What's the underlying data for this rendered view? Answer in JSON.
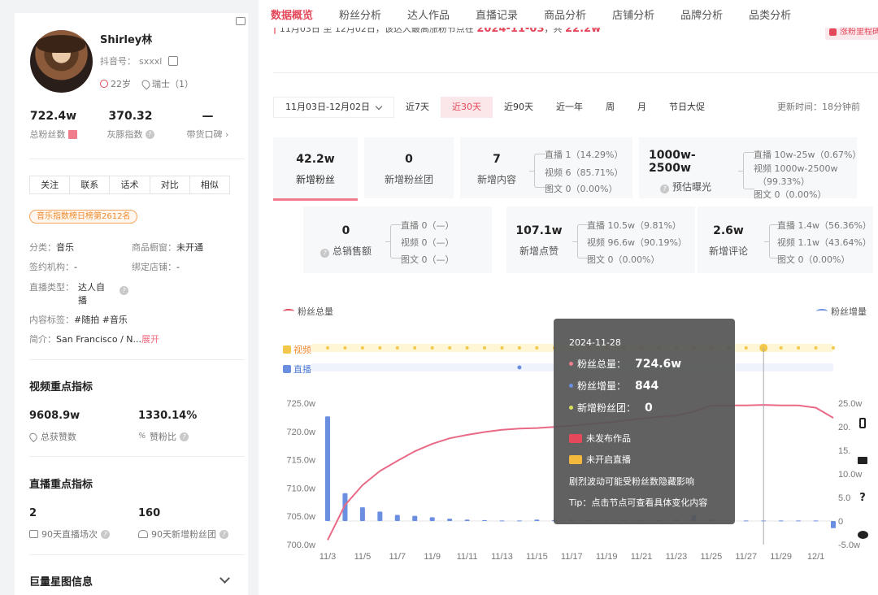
{
  "profile": {
    "name": "Shirley林",
    "douyin_label": "抖音号：",
    "douyin_id": "sxxxl",
    "age": "22岁",
    "location": "瑞士（1）",
    "stats": [
      {
        "value": "722.4w",
        "label": "总粉丝数"
      },
      {
        "value": "370.32",
        "label": "灰豚指数"
      },
      {
        "value": "—",
        "label": "带货口碑 ›"
      }
    ],
    "buttons": [
      "关注",
      "联系",
      "话术",
      "对比",
      "相似"
    ],
    "rank_badge": "音乐指数榜日榜第2612名",
    "info": {
      "category_label": "分类：",
      "category": "音乐",
      "window_label": "商品橱窗：",
      "window": "未开通",
      "agency_label": "签约机构：",
      "agency": "-",
      "shop_label": "绑定店铺：",
      "shop": "-",
      "live_type_label": "直播类型：",
      "live_type_1": "达人自",
      "live_type_2": "播",
      "tags_label": "内容标签：",
      "tags": "#随拍 #音乐",
      "bio_label": "简介：",
      "bio": "San Francisco / N...",
      "expand": "展开"
    },
    "video_section": {
      "title": "视频重点指标",
      "likes_value": "9608.9w",
      "likes_label": "总获赞数",
      "ratio_value": "1330.14%",
      "ratio_label": "赞粉比"
    },
    "live_section": {
      "title": "直播重点指标",
      "sessions_value": "2",
      "sessions_label": "90天直播场次",
      "fangroup_value": "160",
      "fangroup_label": "90天新增粉丝团"
    },
    "star_section": {
      "title": "巨量星图信息"
    }
  },
  "tabs": [
    "数据概览",
    "粉丝分析",
    "达人作品",
    "直播记录",
    "商品分析",
    "店铺分析",
    "品牌分析",
    "品类分析"
  ],
  "active_tab": 0,
  "banner": {
    "text": "11月03日 至 12月02日，该达人最高涨粉节点在",
    "date": "2024-11-03",
    "mid": "，共",
    "amount": "22.2w",
    "tag": "涨粉里程碑"
  },
  "filter": {
    "date_range": "11月03日-12月02日",
    "options": [
      "近7天",
      "近30天",
      "近90天",
      "近一年",
      "周",
      "月",
      "节日大促"
    ],
    "selected": "近30天",
    "update_time": "更新时间：18分钟前"
  },
  "cards": {
    "new_fans": {
      "value": "42.2w",
      "label": "新增粉丝"
    },
    "new_fangroup": {
      "value": "0",
      "label": "新增粉丝团"
    },
    "new_content": {
      "value": "7",
      "label": "新增内容",
      "sub": [
        "直播  1（14.29%）",
        "视频  6（85.71%）",
        "图文  0（0.00%）"
      ]
    },
    "exposure": {
      "value1": "1000w-",
      "value2": "2500w",
      "label": "预估曝光",
      "sub": [
        "直播  10w-25w（0.67%）",
        "视频  1000w-2500w",
        "（99.33%）",
        "图文  0（0.00%）"
      ]
    },
    "sales": {
      "value": "0",
      "label": "总销售额",
      "sub": [
        "直播  0（—）",
        "视频  0（—）",
        "图文  0（—）"
      ]
    },
    "likes": {
      "value": "107.1w",
      "label": "新增点赞",
      "sub": [
        "直播  10.5w（9.81%）",
        "视频  96.6w（90.19%）",
        "图文  0（0.00%）"
      ]
    },
    "comments": {
      "value": "2.6w",
      "label": "新增评论",
      "sub": [
        "直播  1.4w（56.36%）",
        "视频  1.1w（43.64%）",
        "图文  0（0.00%）"
      ]
    }
  },
  "chart_data": {
    "type": "line",
    "legend_left": "粉丝总量",
    "legend_right": "粉丝增量",
    "track_video": "视频",
    "track_live": "直播",
    "x_ticks": [
      "11/3",
      "11/5",
      "11/7",
      "11/9",
      "11/11",
      "11/13",
      "11/15",
      "11/17",
      "11/19",
      "11/21",
      "11/23",
      "11/25",
      "11/27",
      "11/29",
      "12/1"
    ],
    "y_left_ticks": [
      "725.0w",
      "720.0w",
      "715.0w",
      "710.0w",
      "705.0w",
      "700.0w"
    ],
    "y_right_ticks": [
      "25.0w",
      "20.",
      "15.",
      "10.0w",
      "5.0",
      "0",
      "-5.0w"
    ],
    "y_left_range": [
      700,
      725
    ],
    "y_right_range": [
      -5,
      25
    ],
    "total_fans": [
      700.8,
      707.0,
      710.5,
      713.0,
      714.8,
      716.5,
      717.8,
      718.8,
      719.4,
      719.9,
      720.3,
      720.5,
      720.6,
      720.8,
      721.0,
      721.3,
      721.6,
      721.9,
      722.3,
      722.6,
      722.8,
      723.5,
      724.6,
      724.6,
      724.6,
      724.7,
      724.6,
      724.6,
      724.2,
      722.4
    ],
    "fan_increment": [
      22.2,
      5.9,
      2.9,
      2.0,
      1.3,
      1.1,
      0.8,
      0.5,
      0.3,
      0.2,
      0.1,
      0.1,
      0.3,
      0.2,
      0.3,
      0.2,
      0.1,
      0.2,
      0.1,
      0.2,
      0.3,
      1.2,
      0.3,
      0.1,
      0.1,
      0.1,
      0.1,
      0.1,
      0.1,
      -1.5
    ],
    "tooltip": {
      "date": "2024-11-28",
      "total_label": "粉丝总量：",
      "total_value": "724.6w",
      "incr_label": "粉丝增量：",
      "incr_value": "844",
      "group_label": "新增粉丝团：",
      "group_value": "0",
      "no_video": "未发布作品",
      "no_live": "未开启直播",
      "note": "剧烈波动可能受粉丝数隐藏影响",
      "tip": "Tip：点击节点可查看具体变化内容"
    }
  },
  "colors": {
    "accent": "#e5485b",
    "bar": "#6b8fe0",
    "line": "#e86a87",
    "track_yellow": "#f3c84a"
  }
}
